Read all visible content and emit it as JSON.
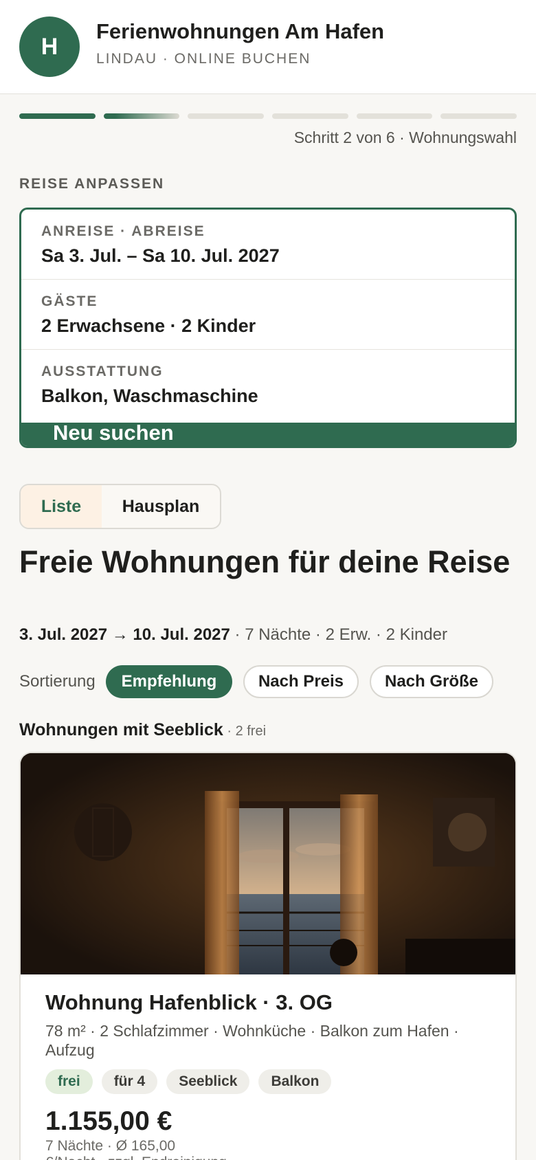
{
  "header": {
    "logo_letter": "H",
    "title": "Ferienwohnungen Am Hafen",
    "subtitle": "LINDAU · ONLINE BUCHEN"
  },
  "progress": {
    "current_step": 2,
    "total_steps": 6,
    "label": "Schritt 2 von 6 · Wohnungswahl"
  },
  "trip": {
    "section_title": "REISE ANPASSEN",
    "rows": [
      {
        "label": "ANREISE · ABREISE",
        "value": "Sa 3. Jul. – Sa 10. Jul. 2027"
      },
      {
        "label": "GÄSTE",
        "value": "2 Erwachsene · 2 Kinder"
      },
      {
        "label": "AUSSTATTUNG",
        "value": "Balkon, Waschmaschine"
      }
    ],
    "search_button": "Neu suchen"
  },
  "view_toggle": {
    "list": "Liste",
    "plan": "Hausplan",
    "selected": "Liste"
  },
  "results": {
    "title": "Freie Wohnungen für deine Reise",
    "dates": "3. Jul. 2027 → 10. Jul. 2027",
    "summary": " · 7 Nächte · 2 Erw. · 2 Kinder"
  },
  "sort": {
    "label": "Sortierung",
    "options": [
      "Empfehlung",
      "Nach Preis",
      "Nach Größe"
    ],
    "selected": "Empfehlung"
  },
  "group": {
    "title": "Wohnungen mit Seeblick",
    "count": " · 2 frei"
  },
  "apartment": {
    "name": "Wohnung Hafenblick · 3. OG",
    "description": "78 m² · 2 Schlafzimmer · Wohnküche · Balkon zum Hafen · Aufzug",
    "tags": [
      "frei",
      "für 4",
      "Seeblick",
      "Balkon"
    ],
    "price": "1.155,00 €",
    "price_detail": "7 Nächte · Ø 165,00",
    "price_detail2": "€/Nacht · zzgl. Endreinigung"
  },
  "colors": {
    "accent": "#2f6b50",
    "background": "#f8f7f4",
    "toggle_active_bg": "#fdf1e4",
    "tag_green_bg": "#e3eedc"
  }
}
